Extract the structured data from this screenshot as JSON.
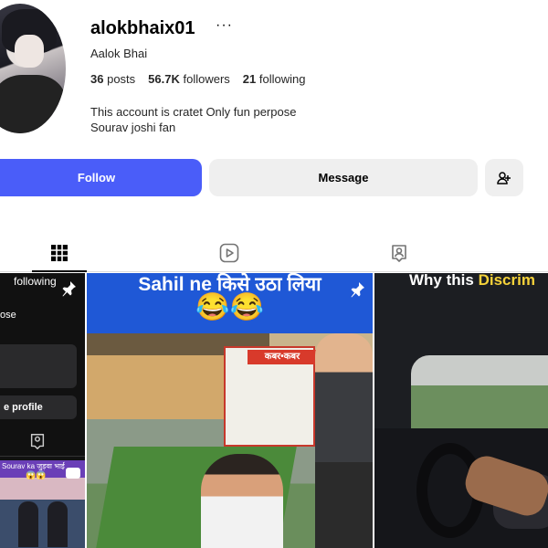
{
  "profile": {
    "username": "alokbhaix01",
    "full_name": "Aalok Bhai",
    "stats": {
      "posts_value": "36",
      "posts_label": "posts",
      "followers_value": "56.7K",
      "followers_label": "followers",
      "following_value": "21",
      "following_label": "following"
    },
    "bio_line1": "This account is cratet Only fun perpose",
    "bio_line2": "Sourav joshi fan"
  },
  "actions": {
    "follow_label": "Follow",
    "message_label": "Message"
  },
  "tabs": [
    "posts",
    "reels",
    "tagged"
  ],
  "grid": {
    "post1": {
      "following_text": "following",
      "fragment_text": "ose",
      "profile_text": "e profile",
      "thumb_caption": "Sourav ka जुड़वा भाई",
      "thumb_emoji": "😱😱"
    },
    "post2": {
      "caption": "Sahil ne किसे उठा लिया",
      "emoji": "😂😂",
      "sign_text": "कबर•कबर"
    },
    "post3": {
      "caption_prefix": "Why this",
      "caption_highlight": "Discrim"
    }
  },
  "colors": {
    "follow_blue": "#4a5df9",
    "secondary_bg": "#efefef",
    "text": "#262626"
  },
  "icons": {
    "more": "more-icon",
    "add_user": "add-user-icon",
    "posts_tab": "grid-icon",
    "reels_tab": "reels-icon",
    "tagged_tab": "tagged-icon",
    "pinned": "pin-icon"
  }
}
